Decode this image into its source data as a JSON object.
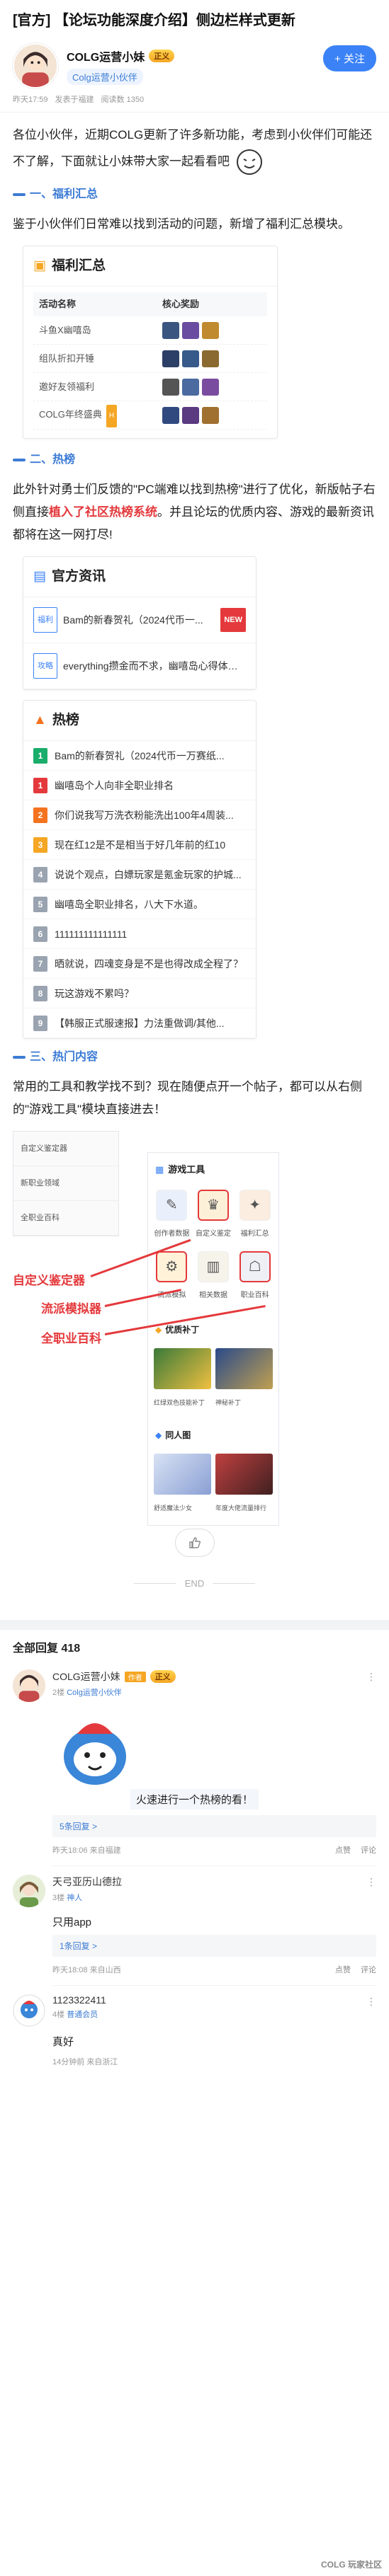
{
  "post": {
    "title": "[官方] 【论坛功能深度介绍】侧边栏样式更新",
    "author": {
      "name": "COLG运营小妹",
      "badge": "正义",
      "group": "Colg运营小伙伴"
    },
    "follow_label": "+ 关注",
    "meta": {
      "time": "昨天17:59",
      "publish": "发表于福建",
      "views": "阅读数 1350"
    }
  },
  "article": {
    "intro": "各位小伙伴，近期COLG更新了许多新功能，考虑到小伙伴们可能还不了解，下面就让小妹带大家一起看看吧",
    "sec1_title": "一、福利汇总",
    "sec1_text": "鉴于小伙伴们日常难以找到活动的问题，新增了福利汇总模块。",
    "sec2_title": "二、热榜",
    "sec2_text_a": "此外针对勇士们反馈的\"PC端难以找到热榜\"进行了优化，新版帖子右侧直接",
    "sec2_text_hl": "植入了社区热榜系统",
    "sec2_text_b": "。并且论坛的优质内容、游戏的最新资讯都将在这一网打尽!",
    "sec3_title": "三、热门内容",
    "sec3_text": "常用的工具和教学找不到？现在随便点开一个帖子，都可以从右侧的\"游戏工具\"模块直接进去！"
  },
  "fuli": {
    "title": "福利汇总",
    "col_name": "活动名称",
    "col_reward": "核心奖励",
    "rows": [
      {
        "name": "斗鱼X幽嘻岛",
        "hot": ""
      },
      {
        "name": "组队折扣开锤",
        "hot": ""
      },
      {
        "name": "邀好友领福利",
        "hot": ""
      },
      {
        "name": "COLG年终盛典",
        "hot": "H"
      }
    ]
  },
  "news": {
    "title": "官方资讯",
    "items": [
      {
        "tag": "福利",
        "text": "Bam的新春贺礼（2024代币一...",
        "new": "NEW"
      },
      {
        "tag": "攻略",
        "text": "everything攒金而不求，幽嘻岛心得体验分享",
        "new": ""
      }
    ]
  },
  "hot": {
    "title": "热榜",
    "items": [
      {
        "rank": "1",
        "text": "Bam的新春贺礼（2024代币一万赛纸..."
      },
      {
        "rank": "1",
        "text": "幽嘻岛个人向非全职业排名"
      },
      {
        "rank": "2",
        "text": "你们说我写万洗衣粉能洗出100年4周装..."
      },
      {
        "rank": "3",
        "text": "现在红12是不是相当于好几年前的红10"
      },
      {
        "rank": "4",
        "text": "说说个观点，白嫖玩家是氪金玩家的护城..."
      },
      {
        "rank": "5",
        "text": "幽嘻岛全职业排名，八大下水道。"
      },
      {
        "rank": "6",
        "text": "111111111111111"
      },
      {
        "rank": "7",
        "text": "晒就说，四魂变身是不是也得改成全程了？"
      },
      {
        "rank": "8",
        "text": "玩这游戏不累吗？"
      },
      {
        "rank": "9",
        "text": "【韩服正式服速报】力法重做调/其他..."
      }
    ]
  },
  "tools": {
    "sidebar_items": [
      "自定义鉴定器",
      "新职业领域",
      "全职业百科"
    ],
    "title": "游戏工具",
    "items": [
      "创作者数据",
      "自定义鉴定",
      "福利汇总",
      "流派模拟",
      "相关数据",
      "职业百科"
    ],
    "sub1": "优质补丁",
    "cards": [
      "红绿双色技能补丁",
      "神秘补丁",
      "",
      ""
    ],
    "sub2": "同人图",
    "cards2": [
      "舒适魔法少女",
      "年度大佬流量排行"
    ],
    "callouts": [
      "自定义鉴定器",
      "流派模拟器",
      "全职业百科"
    ]
  },
  "end_label": "END",
  "replies": {
    "header": "全部回复 418",
    "list": [
      {
        "name": "COLG运营小妹",
        "author_badge": "作者",
        "badge": "正义",
        "floor": "2楼",
        "group": "Colg运营小伙伴",
        "body": "火速进行一个热榜的看！",
        "subreply": "5条回复 >",
        "time": "昨天18:06",
        "location": "来自福建",
        "like": "点赞",
        "comment": "评论"
      },
      {
        "name": "天弓亚历山德拉",
        "author_badge": "",
        "badge": "",
        "floor": "3楼",
        "group": "神人",
        "body": "只用app",
        "subreply": "1条回复 >",
        "time": "昨天18:08",
        "location": "来自山西",
        "like": "点赞",
        "comment": "评论"
      },
      {
        "name": "1123322411",
        "author_badge": "",
        "badge": "",
        "floor": "4楼",
        "group": "普通会员",
        "body": "真好",
        "subreply": "",
        "time": "14分钟前",
        "location": "来自浙江",
        "like": "点赞",
        "comment": "评论"
      }
    ]
  },
  "watermark": "COLG 玩家社区"
}
